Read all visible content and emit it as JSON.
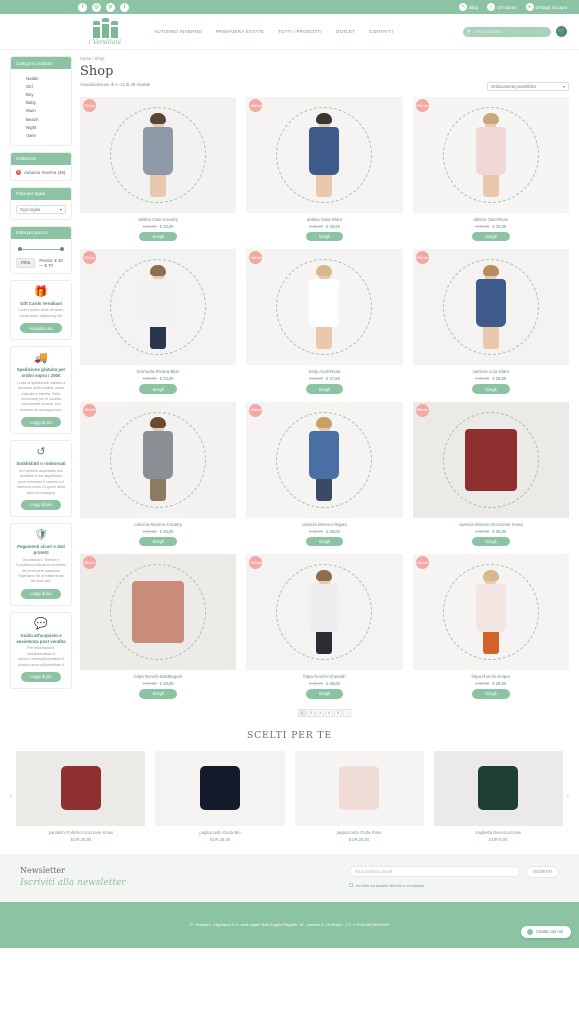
{
  "topbar": {
    "social": [
      {
        "name": "facebook-icon",
        "glyph": "f"
      },
      {
        "name": "instagram-icon",
        "glyph": "◎"
      },
      {
        "name": "pinterest-icon",
        "glyph": "p"
      },
      {
        "name": "twitter-icon",
        "glyph": "t"
      }
    ],
    "links": [
      {
        "label": "Blog",
        "icon": "blog-icon",
        "glyph": "✎"
      },
      {
        "label": "Chi siamo",
        "icon": "info-icon",
        "glyph": "i"
      },
      {
        "label": "Dettagli account",
        "icon": "account-icon",
        "glyph": "●"
      }
    ]
  },
  "header": {
    "brand": "i Versiliani",
    "nav": [
      "AUTUNNO INVERNO",
      "PRIMAVERA ESTATE",
      "TUTTI I PRODOTTI",
      "OUTLET",
      "CONTATTI"
    ],
    "search_placeholder": "Cerca prodotti...",
    "search_value": "",
    "cart_icon": "cart-icon"
  },
  "sidebar": {
    "categories": {
      "title": "Categorie prodotto",
      "items": [
        "Natale",
        "Girl",
        "Boy",
        "Baby",
        "Mum",
        "Beach",
        "Night",
        "Varie"
      ]
    },
    "collection": {
      "title": "Collezione",
      "active": "Autunno Inverno (49)"
    },
    "size_filter": {
      "title": "Filtra per taglia",
      "selected": "Ogni taglia"
    },
    "price_filter": {
      "title": "Filtra per prezzo",
      "button": "Filtra",
      "range_label": "Prezzo: € 30 — € 70",
      "min": 30,
      "max": 70
    },
    "promos": [
      {
        "icon": "gift-card-icon",
        "glyph": "Ἰ1",
        "title": "Gift Cards Versiliani",
        "text": "Lorem ipsum dolor sit amet, consectetur adipiscing elit.",
        "button": "Acquista ora"
      },
      {
        "icon": "truck-icon",
        "glyph": "Ὡa",
        "title": "Spedizione gratuita per ordini sopra i 200€",
        "text": "I costi di spedizione variano a seconda della località, come indicato in tabella. Fatto eccezione per le località considerate remote, che avranno un sovrapprezzo.",
        "button": "Leggi di più"
      },
      {
        "icon": "return-arrow-icon",
        "glyph": "↺",
        "title": "Soddisfatti o rimborsati",
        "text": "Se l'articolo acquistato non soddisfa le tue aspettative puoi richiedere il cambio o il rimborso entro 14 giorni dalla data di consegna.",
        "button": "Leggi di più"
      },
      {
        "icon": "shield-icon",
        "glyph": "Ὦ1",
        "title": "Pagamenti sicuri e dati protetti",
        "text": "Accettando i Termini e Condizioni indicati al momento del preordine autorizza HighNano Srl al trattamento dei suoi dati.",
        "button": "Leggi di più"
      },
      {
        "icon": "chat-bubbles-icon",
        "glyph": "Ὂc",
        "title": "Guida all'acquisto e assistenza post vendita",
        "text": "Per informazioni: info@iversiliani.it roberto.roberta@iversiliani.it AmaLe.anna.a@iversiliani.it",
        "button": "Leggi di più"
      }
    ]
  },
  "shop": {
    "breadcrumb": "Home / Shop",
    "title": "Shop",
    "result_count": "Visualizzazione di 1–12 di 49 risultati",
    "sort_selected": "Ordinamento predefinito",
    "badge_label": "Offerta!",
    "buy_label": "Scegli",
    "products": [
      {
        "name": "abitino Oasi-Country",
        "old_price": "€ 46,00",
        "price": "€ 33,00",
        "sale": true,
        "art": {
          "hair": "#5b4636",
          "body": "#8f9aa8",
          "legs": "#e8c9ae",
          "bg": "#f3f2f0"
        }
      },
      {
        "name": "abitino Oasi-Glam",
        "old_price": "€ 46,00",
        "price": "€ 33,00",
        "sale": true,
        "art": {
          "hair": "#3a3630",
          "body": "#3f5b8c",
          "legs": "#e8c9ae",
          "bg": "#f5f4f2"
        }
      },
      {
        "name": "abitino Oasi-Rose",
        "old_price": "€ 44,00",
        "price": "€ 33,00",
        "sale": true,
        "art": {
          "hair": "#c9a87c",
          "body": "#f0d8d6",
          "legs": "#e8c9ae",
          "bg": "#f6f5f3"
        }
      },
      {
        "name": "bermuda Riviera-Blue",
        "old_price": "€ 30,00",
        "price": "€ 23,00",
        "sale": true,
        "art": {
          "hair": "#8b6f4e",
          "body": "#f2f2f2",
          "legs": "#2a3550",
          "bg": "#f4f3f1"
        }
      },
      {
        "name": "body Acali-Rosa",
        "old_price": "€ 24,00",
        "price": "€ 17,50",
        "sale": true,
        "art": {
          "hair": "#d8b98c",
          "body": "#ffffff",
          "legs": "#e8c9ae",
          "bg": "#f5f4f2"
        }
      },
      {
        "name": "camicia Lulu-Glam",
        "old_price": "€ 36,00",
        "price": "€ 28,00",
        "sale": true,
        "art": {
          "hair": "#b88c5a",
          "body": "#3f5b8c",
          "legs": "#e8c9ae",
          "bg": "#f4f3f1"
        }
      },
      {
        "name": "camicia Moreno-Country",
        "old_price": "€ 32,00",
        "price": "€ 25,00",
        "sale": true,
        "art": {
          "hair": "#6b4a2f",
          "body": "#8a8f96",
          "legs": "#8c7a63",
          "bg": "#f3f2f0"
        }
      },
      {
        "name": "camicia Moreno-Rigato",
        "old_price": "€ 32,00",
        "price": "€ 25,00",
        "sale": true,
        "art": {
          "hair": "#c9a063",
          "body": "#4a6fa5",
          "legs": "#3b4a63",
          "bg": "#f5f4f2"
        }
      },
      {
        "name": "camicia Moreno-Scozzese Xmas",
        "old_price": "€ 32,00",
        "price": "€ 25,00",
        "sale": true,
        "art": {
          "hair": "#7a2a2a",
          "body": "#8e2f2f",
          "legs": "#8e2f2f",
          "bg": "#eceae6",
          "flat": true
        }
      },
      {
        "name": "felpa Ronchi-Bubblegum",
        "old_price": "€ 38,00",
        "price": "€ 29,00",
        "sale": true,
        "art": {
          "hair": "#c98b7a",
          "body": "#c98b7a",
          "legs": "#c98b7a",
          "bg": "#ecebe7",
          "flat": true
        }
      },
      {
        "name": "felpa Ronchi-Cheetah",
        "old_price": "€ 38,00",
        "price": "€ 29,00",
        "sale": true,
        "art": {
          "hair": "#8b6f4e",
          "body": "#eeeef0",
          "legs": "#2b2b33",
          "bg": "#f4f3f1"
        }
      },
      {
        "name": "felpa Ronchi-Sniper",
        "old_price": "€ 38,00",
        "price": "€ 29,00",
        "sale": true,
        "art": {
          "hair": "#d8b98c",
          "body": "#f3e6e2",
          "legs": "#d2612a",
          "bg": "#f5f4f2"
        }
      }
    ],
    "pagination": [
      "1",
      "2",
      "3",
      "4",
      "5",
      "→"
    ],
    "current_page": "1"
  },
  "recommended": {
    "title": "SCELTI PER TE",
    "prev_icon": "chevron-left-icon",
    "next_icon": "chevron-right-icon",
    "items": [
      {
        "name": "pantaloni Fabrizio-Scozzese Xmas",
        "price": "EUR 25.90",
        "color": "#8e3030",
        "bg": "#eceae6"
      },
      {
        "name": "pagliaccetto Onda-Blu",
        "price": "EUR 28.00",
        "color": "#151a2b",
        "bg": "#f4f3f1"
      },
      {
        "name": "pagliaccetto Onda-Rose",
        "price": "EUR 28.00",
        "color": "#f2dcd8",
        "bg": "#f6f5f3"
      },
      {
        "name": "maglietta Diva-Scozzese",
        "price": "EUR 0.00",
        "color": "#1f3f35",
        "bg": "#ebeae8"
      }
    ]
  },
  "newsletter": {
    "title": "Newsletter",
    "subtitle": "Iscriviti alla newsletter",
    "placeholder": "Il tuo indirizzo email",
    "value": "",
    "button": "ISCRIVITI",
    "consent": "ho letto ed accetto termini e condizioni"
  },
  "footer": {
    "copyright": "© i Versiliani - HighNano S.r.l. sede legale Viale Angelo Filippetti, 16 - sezione R | di Milano - C.F. e P.IVA 08788010960",
    "chat_label": "Chatta con noi"
  }
}
